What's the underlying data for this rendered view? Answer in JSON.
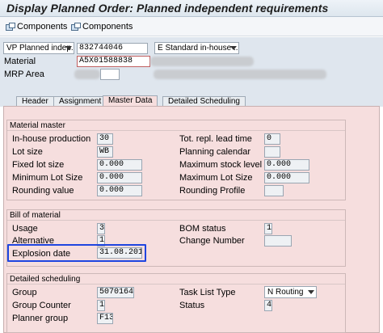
{
  "window": {
    "title": "Display Planned Order: Planned independent requirements"
  },
  "toolbar": {
    "components_1": "Components",
    "components_2": "Components"
  },
  "header": {
    "order_type": "VP Planned indep...",
    "order_number": "832744046",
    "procurement": "E Standard in-house ...",
    "material_label": "Material",
    "material_value": "A5X01588838",
    "mrp_area_label": "MRP Area"
  },
  "tabs": [
    "Header",
    "Assignment",
    "Master Data",
    "Detailed Scheduling"
  ],
  "material_master": {
    "title": "Material master",
    "inhouse_label": "In-house production",
    "inhouse_value": "30",
    "lotsize_label": "Lot size",
    "lotsize_value": "WB",
    "fixedlot_label": "Fixed lot size",
    "fixedlot_value": "0.000",
    "minlot_label": "Minimum Lot Size",
    "minlot_value": "0.000",
    "rounding_label": "Rounding value",
    "rounding_value": "0.000",
    "totrepl_label": "Tot. repl. lead time",
    "totrepl_value": "0",
    "plancal_label": "Planning calendar",
    "plancal_value": "",
    "maxstock_label": "Maximum stock level",
    "maxstock_value": "0.000",
    "maxlot_label": "Maximum Lot Size",
    "maxlot_value": "0.000",
    "roundprof_label": "Rounding Profile",
    "roundprof_value": ""
  },
  "bom": {
    "title": "Bill of material",
    "usage_label": "Usage",
    "usage_value": "3",
    "alt_label": "Alternative",
    "alt_value": "1",
    "explosion_label": "Explosion date",
    "explosion_value": "31.08.2016",
    "bomstatus_label": "BOM status",
    "bomstatus_value": "1",
    "change_label": "Change Number",
    "change_value": ""
  },
  "scheduling": {
    "title": "Detailed scheduling",
    "group_label": "Group",
    "group_value": "50701640",
    "counter_label": "Group Counter",
    "counter_value": "1",
    "planner_label": "Planner group",
    "planner_value": "F13",
    "tasktype_label": "Task List Type",
    "tasktype_value": "N Routing",
    "status_label": "Status",
    "status_value": "4"
  },
  "colors": {
    "highlight": "#1f45e0",
    "panel": "#f6dede"
  }
}
